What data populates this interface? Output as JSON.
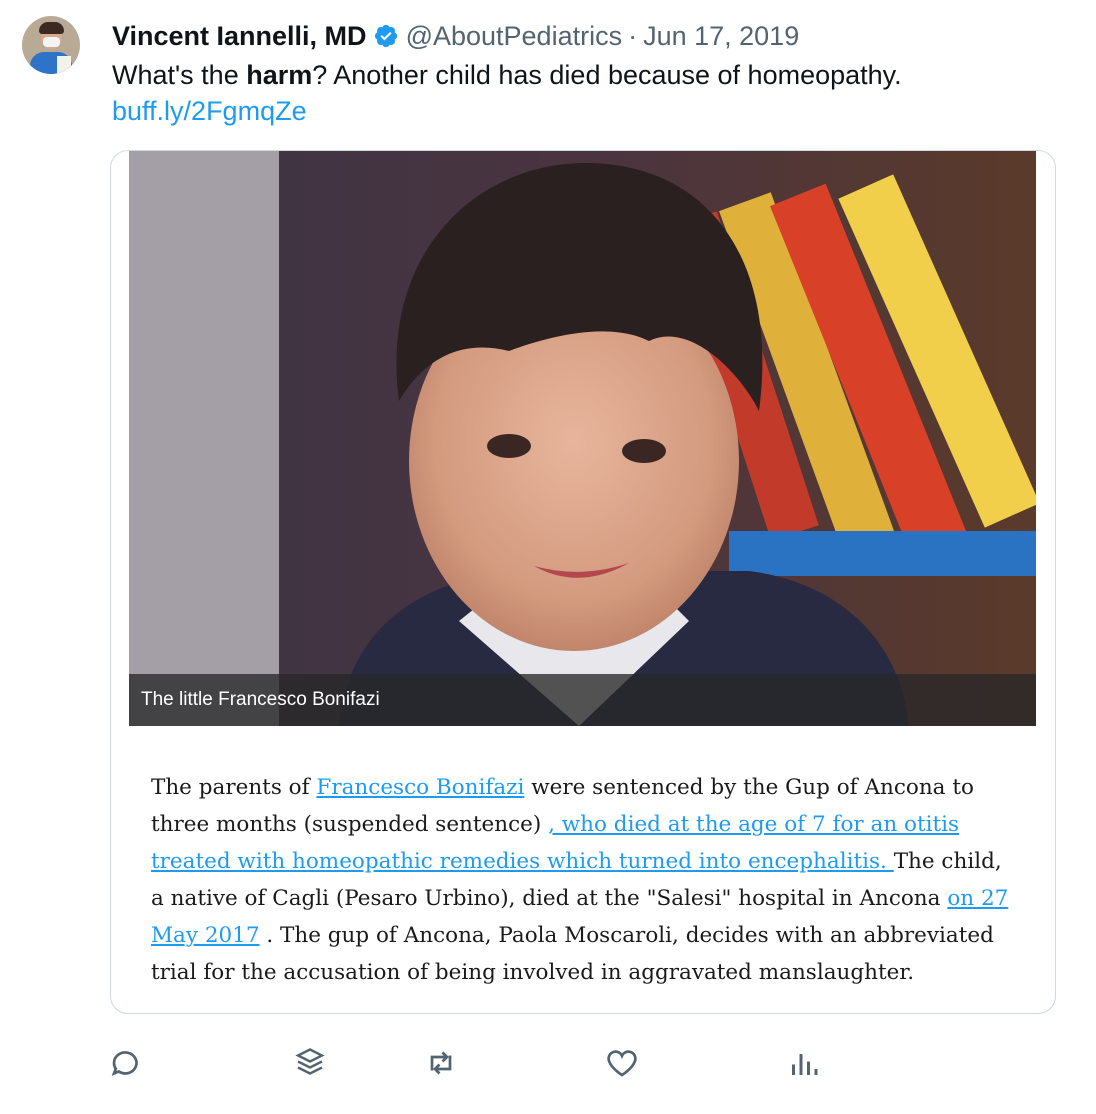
{
  "author": {
    "name": "Vincent Iannelli, MD",
    "handle": "@AboutPediatrics",
    "separator": "·",
    "date": "Jun 17, 2019",
    "verified": true
  },
  "tweet": {
    "text_before": "What's the ",
    "text_bold": "harm",
    "text_after": "? Another child has died because of homeopathy.",
    "link": "buff.ly/2FgmqZe"
  },
  "card": {
    "photo_caption": "The little Francesco Bonifazi",
    "article": {
      "p1": "The parents of ",
      "link1": "Francesco Bonifazi",
      "p2": " were sentenced by the Gup of Ancona to three months (suspended sentence) ",
      "link2": ", who died at the age of 7 for an otitis treated with homeopathic remedies which turned into encephalitis. ",
      "p3": "The child, a native of Cagli (Pesaro Urbino), died at the \"Salesi\" hospital in Ancona ",
      "link3": "on 27 May 2017",
      "p4": " . The gup of Ancona, Paola Moscaroli, decides with an abbreviated trial for the accusation of being involved in aggravated manslaughter."
    }
  },
  "actions": [
    "reply-icon",
    "stack-icon",
    "retweet-icon",
    "like-icon",
    "analytics-icon"
  ],
  "colors": {
    "accent": "#1d9bf0",
    "muted": "#536471",
    "border": "#cfd9de"
  }
}
